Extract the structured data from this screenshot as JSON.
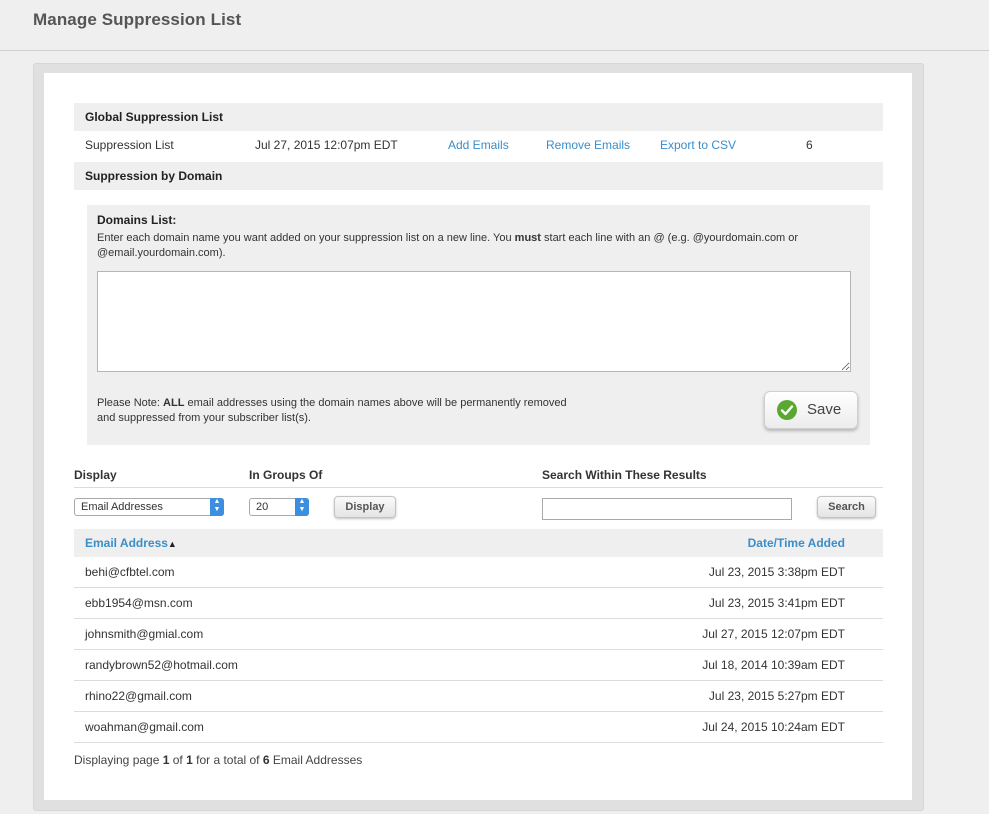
{
  "page_title": "Manage Suppression List",
  "global": {
    "heading": "Global Suppression List",
    "row": {
      "name": "Suppression List",
      "date": "Jul 27, 2015 12:07pm EDT",
      "add_label": "Add Emails",
      "remove_label": "Remove Emails",
      "export_label": "Export to CSV",
      "count": "6"
    }
  },
  "domain_section": {
    "heading": "Suppression by Domain",
    "list_title": "Domains List:",
    "desc_part1": "Enter each domain name you want added on your suppression list on a new line. You ",
    "desc_bold": "must",
    "desc_part2": " start each line with an @ (e.g. @yourdomain.com or @email.yourdomain.com).",
    "textarea_value": "",
    "note_part1": "Please Note: ",
    "note_bold": "ALL",
    "note_part2": " email addresses using the domain names above will be permanently removed and suppressed from your subscriber list(s).",
    "save_label": "Save"
  },
  "controls": {
    "display_label": "Display",
    "display_value": "Email Addresses",
    "groups_label": "In Groups Of",
    "groups_value": "20",
    "display_button": "Display",
    "search_label": "Search Within These Results",
    "search_value": "",
    "search_button": "Search"
  },
  "table": {
    "col_email": "Email Address",
    "sort_indicator": "▲",
    "col_date": "Date/Time Added",
    "rows": [
      {
        "email": "behi@cfbtel.com",
        "date": "Jul 23, 2015 3:38pm EDT"
      },
      {
        "email": "ebb1954@msn.com",
        "date": "Jul 23, 2015 3:41pm EDT"
      },
      {
        "email": "johnsmith@gmial.com",
        "date": "Jul 27, 2015 12:07pm EDT"
      },
      {
        "email": "randybrown52@hotmail.com",
        "date": "Jul 18, 2014 10:39am EDT"
      },
      {
        "email": "rhino22@gmail.com",
        "date": "Jul 23, 2015 5:27pm EDT"
      },
      {
        "email": "woahman@gmail.com",
        "date": "Jul 24, 2015 10:24am EDT"
      }
    ]
  },
  "footer": {
    "prefix": "Displaying page ",
    "page": "1",
    "of": " of ",
    "total_pages": "1",
    "middle": " for a total of ",
    "total": "6",
    "suffix": " Email Addresses"
  },
  "colors": {
    "link": "#3a8ec9",
    "save_icon": "#5aa832",
    "select_arrow": "#3c8ee0"
  }
}
